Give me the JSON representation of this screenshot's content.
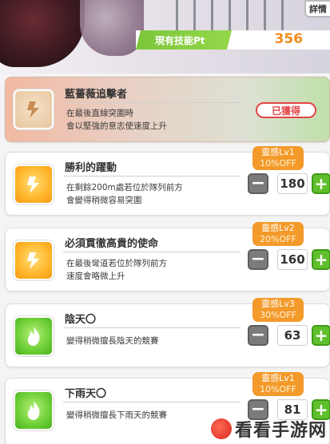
{
  "header": {
    "detail_label": "詳情",
    "skill_pt_label": "現有技能Pt",
    "skill_pt_value": "356"
  },
  "skills": [
    {
      "name": "藍薔薇追擊者",
      "desc": [
        "在最後直線突圍時",
        "會以堅強的意志使速度上升"
      ],
      "acquired_label": "已獲得",
      "icon": "gold-runner-icon"
    },
    {
      "name": "勝利的躍動",
      "desc": [
        "在剩餘200m處若位於隊列前方",
        "會變得稍微容易突圍"
      ],
      "hint_line1": "靈感Lv1",
      "hint_line2": "10%OFF",
      "cost": "180",
      "icon": "gold-runner-icon"
    },
    {
      "name": "必須貫徹高貴的使命",
      "desc": [
        "在最後彎道若位於隊列前方",
        "速度會略微上升"
      ],
      "hint_line1": "靈感Lv2",
      "hint_line2": "20%OFF",
      "cost": "160",
      "icon": "gold-runner-icon"
    },
    {
      "name": "陰天〇",
      "desc": [
        "變得稍微擅長陰天的競賽"
      ],
      "hint_line1": "靈感Lv3",
      "hint_line2": "30%OFF",
      "cost": "63",
      "icon": "green-flame-icon"
    },
    {
      "name": "下雨天〇",
      "desc": [
        "變得稍微擅長下雨天的競賽"
      ],
      "hint_line1": "靈感Lv1",
      "hint_line2": "10%OFF",
      "cost": "81",
      "icon": "green-flame-icon"
    }
  ],
  "watermark": "看看手游网",
  "colors": {
    "accent_orange": "#f08c1a",
    "pt_green": "#7cc63a",
    "acquired_red": "#e24444",
    "plus_green": "#5fbf2c"
  }
}
